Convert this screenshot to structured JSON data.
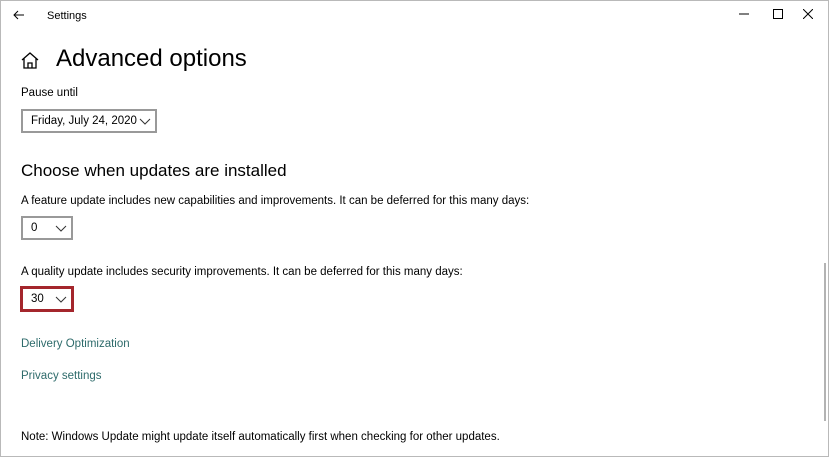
{
  "window": {
    "title": "Settings"
  },
  "header": {
    "title": "Advanced options"
  },
  "pause": {
    "label": "Pause until",
    "value": "Friday, July 24, 2020"
  },
  "updates": {
    "section_title": "Choose when updates are installed",
    "feature": {
      "label": "A feature update includes new capabilities and improvements. It can be deferred for this many days:",
      "value": "0"
    },
    "quality": {
      "label": "A quality update includes security improvements. It can be deferred for this many days:",
      "value": "30"
    }
  },
  "links": {
    "delivery": "Delivery Optimization",
    "privacy": "Privacy settings"
  },
  "note": "Note: Windows Update might update itself automatically first when checking for other updates.",
  "icons": {
    "back": "back-arrow-icon",
    "home": "home-icon",
    "minimize": "minimize-icon",
    "maximize": "maximize-icon",
    "close": "close-icon",
    "chevron": "chevron-down-icon"
  },
  "colors": {
    "link": "#2e6b6b",
    "highlight": "#a4262c"
  }
}
